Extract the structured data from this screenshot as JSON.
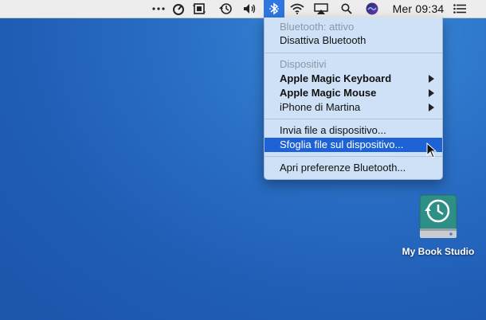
{
  "menubar": {
    "icons": [
      "more-dots-icon",
      "activity-gauge-icon",
      "screen-capture-icon",
      "time-machine-icon",
      "volume-icon",
      "bluetooth-icon",
      "wifi-icon",
      "airplay-icon",
      "search-icon",
      "siri-icon",
      "menu-list-icon"
    ],
    "clock": "Mer 09:34"
  },
  "bluetooth_menu": {
    "status": "Bluetooth: attivo",
    "toggle": "Disattiva Bluetooth",
    "devices_header": "Dispositivi",
    "devices": [
      {
        "label": "Apple Magic Keyboard",
        "has_submenu": true
      },
      {
        "label": "Apple Magic Mouse",
        "has_submenu": true
      },
      {
        "label": "iPhone di Martina",
        "has_submenu": true
      }
    ],
    "send_file": "Invia file a dispositivo...",
    "browse_files": "Sfoglia file sul dispositivo...",
    "preferences": "Apri preferenze Bluetooth..."
  },
  "desktop": {
    "drive_label": "My Book Studio"
  },
  "colors": {
    "highlight": "#1e63d6",
    "menu_bg": "#d4e4f7",
    "desktop": "#2a6fc6",
    "drive_teal": "#2e8f86"
  }
}
